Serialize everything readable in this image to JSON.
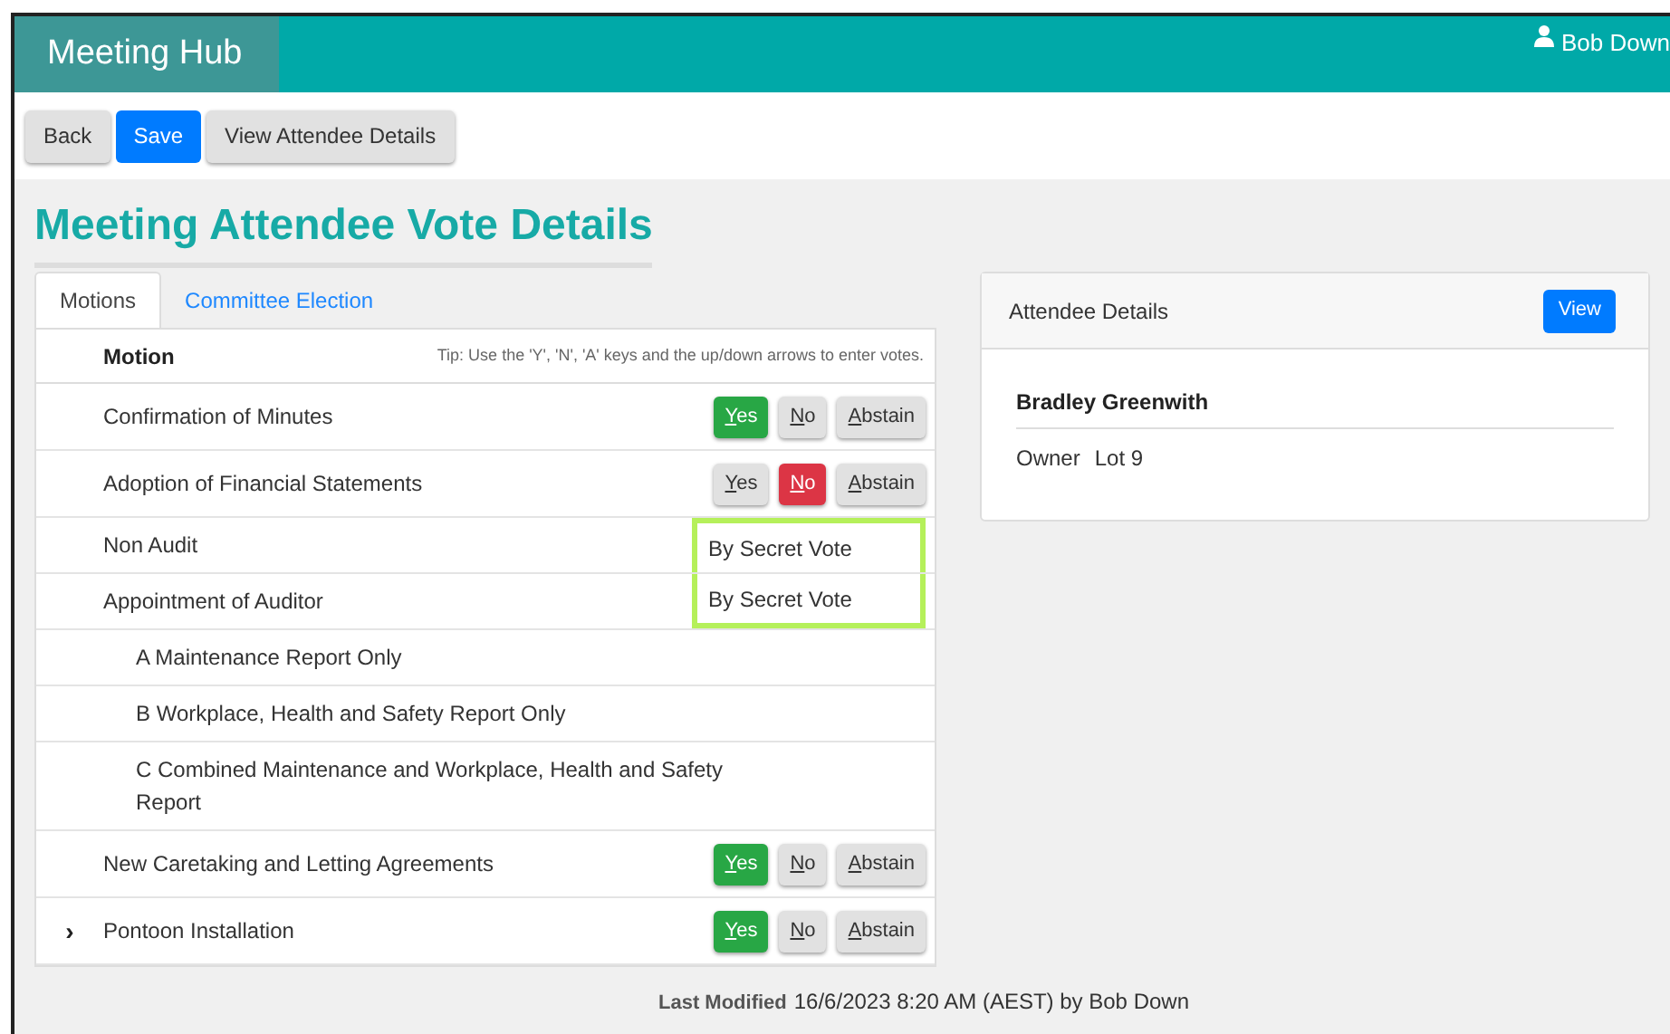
{
  "header": {
    "brand": "Meeting Hub",
    "user": "Bob Down"
  },
  "toolbar": [
    {
      "label": "Back",
      "kind": "default"
    },
    {
      "label": "Save",
      "kind": "primary"
    },
    {
      "label": "View Attendee Details",
      "kind": "default"
    }
  ],
  "page_title": "Meeting Attendee Vote Details",
  "tabs": [
    {
      "label": "Motions",
      "selected": true
    },
    {
      "label": "Committee Election",
      "selected": false
    }
  ],
  "table": {
    "column": "Motion",
    "tip": "Tip: Use the 'Y', 'N', 'A' keys and the up/down arrows to enter votes.",
    "rows": [
      {
        "title": "Confirmation of Minutes",
        "kind": "vote",
        "buttons": [
          {
            "label": "Yes",
            "kind": "yes",
            "selected": true
          },
          {
            "label": "No",
            "kind": "no",
            "selected": false
          },
          {
            "label": "Abstain",
            "kind": "abstain",
            "selected": false
          }
        ]
      },
      {
        "title": "Adoption of Financial Statements",
        "kind": "vote",
        "buttons": [
          {
            "label": "Yes",
            "kind": "yes",
            "selected": false
          },
          {
            "label": "No",
            "kind": "no",
            "selected": true
          },
          {
            "label": "Abstain",
            "kind": "abstain",
            "selected": false
          }
        ]
      },
      {
        "title": "Non Audit",
        "kind": "secret",
        "note": "By Secret Vote",
        "highlighted": true
      },
      {
        "title": "Appointment of Auditor",
        "kind": "secret",
        "note": "By Secret Vote",
        "highlighted": true,
        "children": [
          {
            "title": "A Maintenance Report Only"
          },
          {
            "title": "B Workplace, Health and Safety Report Only"
          },
          {
            "title": "C Combined Maintenance and Workplace, Health and Safety Report"
          }
        ]
      },
      {
        "title": "New Caretaking and Letting Agreements",
        "kind": "vote",
        "buttons": [
          {
            "label": "Yes",
            "kind": "yes",
            "selected": true
          },
          {
            "label": "No",
            "kind": "no",
            "selected": false
          },
          {
            "label": "Abstain",
            "kind": "abstain",
            "selected": false
          }
        ]
      },
      {
        "title": "Pontoon Installation",
        "kind": "vote",
        "toggle": "›",
        "buttons": [
          {
            "label": "Yes",
            "kind": "yes",
            "selected": true
          },
          {
            "label": "No",
            "kind": "no",
            "selected": false
          },
          {
            "label": "Abstain",
            "kind": "abstain",
            "selected": false
          }
        ]
      }
    ]
  },
  "attendee": {
    "heading": "Attendee Details",
    "button": "View",
    "name": "Bradley Greenwith",
    "role": "Owner",
    "lot": "Lot 9"
  },
  "footer": {
    "label": "Last Modified",
    "value": "16/6/2023 8:20 AM (AEST) by Bob Down"
  }
}
